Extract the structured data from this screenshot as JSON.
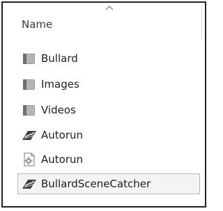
{
  "column_header": {
    "name_label": "Name"
  },
  "items": [
    {
      "label": "Bullard",
      "icon": "folder-icon"
    },
    {
      "label": "Images",
      "icon": "folder-icon"
    },
    {
      "label": "Videos",
      "icon": "folder-icon"
    },
    {
      "label": "Autorun",
      "icon": "app-icon"
    },
    {
      "label": "Autorun",
      "icon": "settings-file-icon"
    },
    {
      "label": "BullardSceneCatcher",
      "icon": "app-icon",
      "selected": true
    }
  ]
}
